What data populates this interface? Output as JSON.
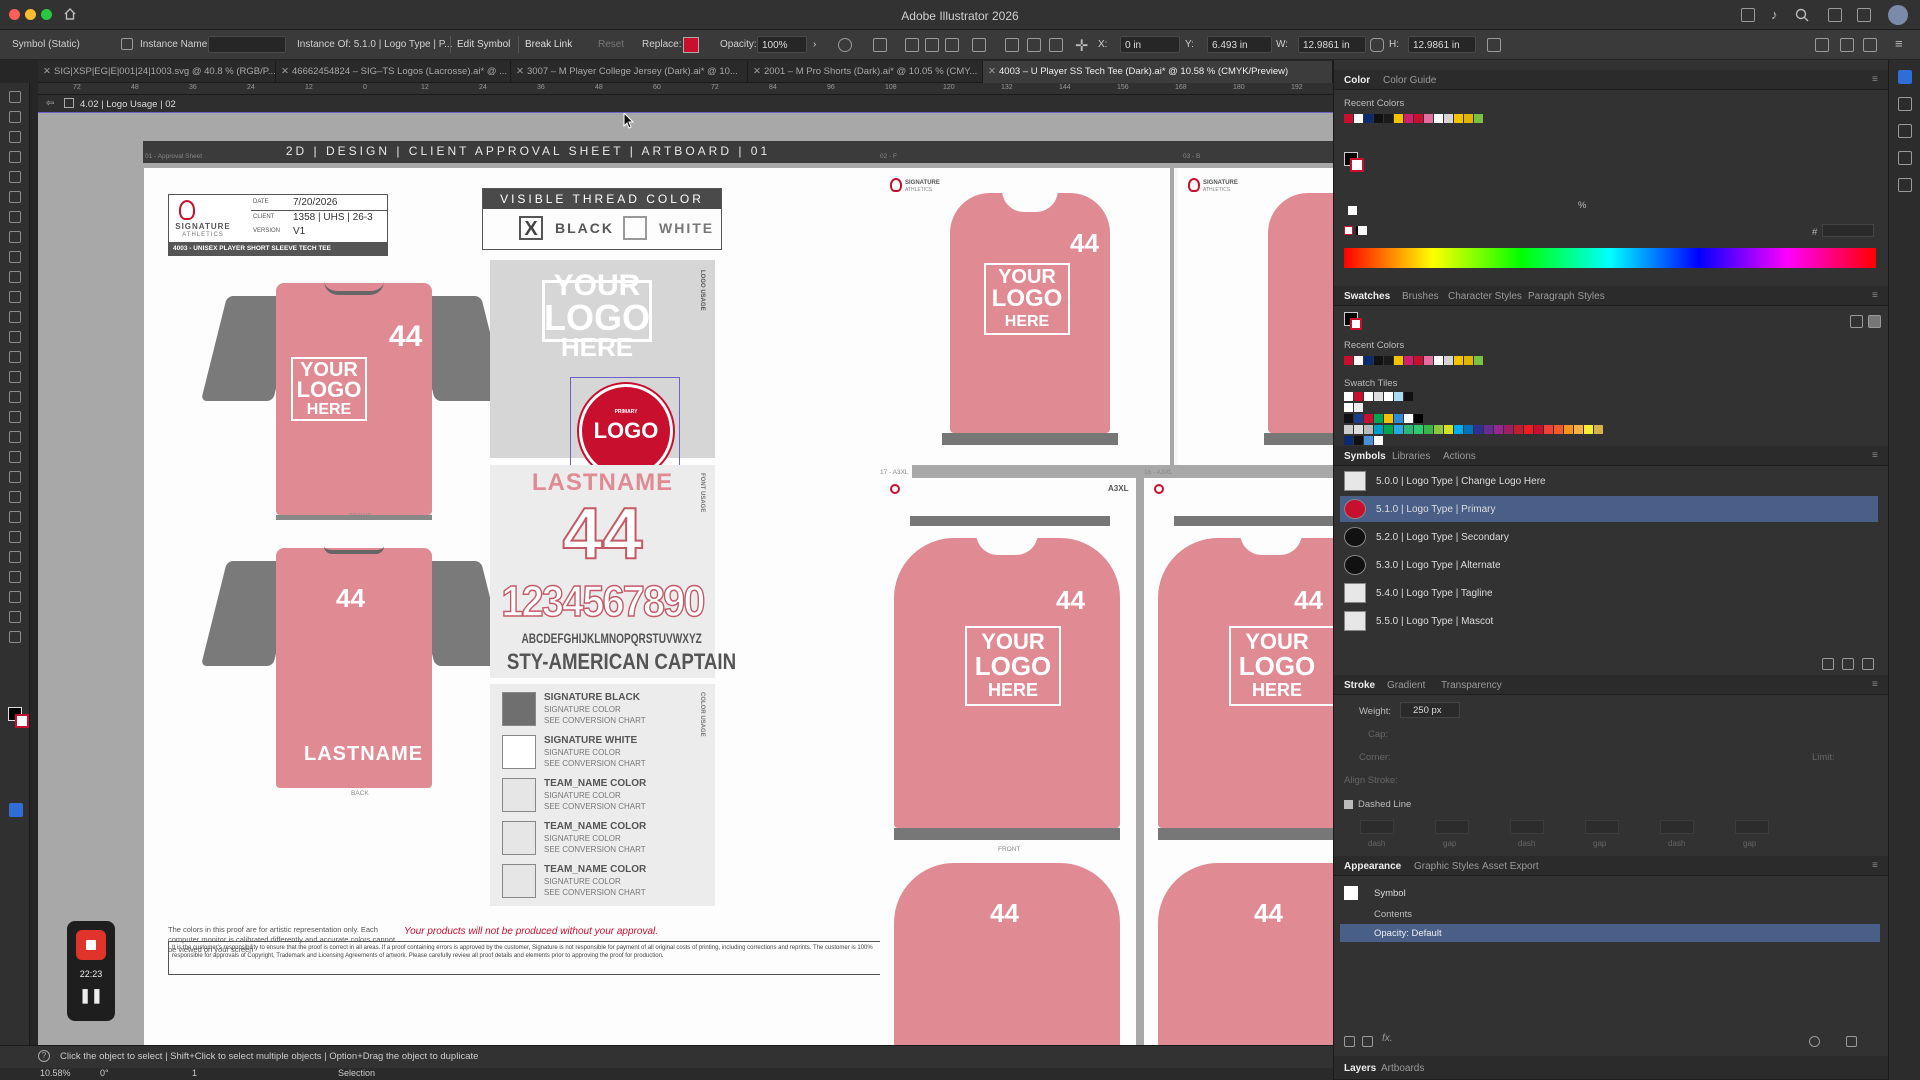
{
  "app": {
    "title": "Adobe Illustrator 2026"
  },
  "control_bar": {
    "selection_type": "Symbol (Static)",
    "instance_name_label": "Instance Name:",
    "instance_of": "Instance Of: 5.1.0 | Logo Type | P...",
    "edit_symbol": "Edit Symbol",
    "break_link": "Break Link",
    "reset": "Reset",
    "replace_label": "Replace:",
    "opacity_label": "Opacity:",
    "opacity_value": "100%",
    "x_label": "X:",
    "x_value": "0 in",
    "y_label": "Y:",
    "y_value": "6.493 in",
    "w_label": "W:",
    "w_value": "12.9861 in",
    "h_label": "H:",
    "h_value": "12.9861 in"
  },
  "doc_tabs": [
    "SIG|XSP|EG|E|001|24|1003.svg @ 40.8 % (RGB/P...",
    "46662454824 – SIG–TS Logos (Lacrosse).ai* @ ...",
    "3007 – M Player College Jersey (Dark).ai* @ 10...",
    "2001 – M Pro Shorts (Dark).ai* @ 10.05 % (CMY...",
    "4003 – U Player SS Tech Tee (Dark).ai* @ 10.58 % (CMYK/Preview)"
  ],
  "isolation": {
    "label": "4.02 | Logo Usage | 02"
  },
  "ruler_ticks": [
    "72",
    "48",
    "36",
    "24",
    "12",
    "0",
    "12",
    "24",
    "36",
    "48",
    "60",
    "72",
    "84",
    "96",
    "108",
    "120",
    "132",
    "144",
    "156",
    "168",
    "180",
    "192"
  ],
  "artboard": {
    "header": "2D  |  DESIGN  |  CLIENT APPROVAL SHEET  |  ARTBOARD  |  01",
    "artboard_name": "01 - Approval Sheet",
    "info": {
      "date_label": "DATE",
      "date": "7/20/2026",
      "client_label": "CLIENT",
      "client": "1358 | UHS | 26-3",
      "version_label": "VERSION",
      "version": "V1",
      "brand": "SIGNATURE",
      "brand_sub": "ATHLETICS",
      "product": "4003 - UNISEX PLAYER SHORT SLEEVE TECH TEE"
    },
    "thread": {
      "title": "VISIBLE THREAD COLOR",
      "black": "BLACK",
      "white": "WHITE",
      "checked_mark": "X"
    },
    "logo_usage_label": "LOGO USAGE",
    "your_logo": [
      "YOUR",
      "LOGO",
      "HERE"
    ],
    "primary_logo_small": "PRIMARY",
    "primary_logo": "LOGO",
    "font_usage_label": "FONT USAGE",
    "lastname": "LASTNAME",
    "number": "44",
    "digits": "1234567890",
    "alphabet": "ABCDEFGHIJKLMNOPQRSTUVWXYZ",
    "font_name": "STY-AMERICAN CAPTAIN",
    "color_usage_label": "COLOR USAGE",
    "colors": [
      {
        "name": "SIGNATURE BLACK",
        "l1": "SIGNATURE COLOR",
        "l2": "SEE CONVERSION CHART",
        "hex": "#6f6f6f"
      },
      {
        "name": "SIGNATURE WHITE",
        "l1": "SIGNATURE COLOR",
        "l2": "SEE CONVERSION CHART",
        "hex": "#ffffff"
      },
      {
        "name": "TEAM_NAME COLOR",
        "l1": "SIGNATURE COLOR",
        "l2": "SEE CONVERSION CHART",
        "hex": "#e6e6e6"
      },
      {
        "name": "TEAM_NAME COLOR",
        "l1": "SIGNATURE COLOR",
        "l2": "SEE CONVERSION CHART",
        "hex": "#e6e6e6"
      },
      {
        "name": "TEAM_NAME COLOR",
        "l1": "SIGNATURE COLOR",
        "l2": "SEE CONVERSION CHART",
        "hex": "#e6e6e6"
      }
    ],
    "front_label": "FRONT",
    "back_label": "BACK",
    "back_name": "LASTNAME",
    "disclaimer": "The colors in this proof are for artistic representation only. Each computer monitor is calibrated differently and accurate colors cannot be viewed on your screen",
    "warning": "Your products will not be produced without your approval.",
    "legal": "It is the customer's responsibility to ensure that the proof is correct in all areas. If a proof containing errors is approved by the customer, Signature is not responsible for payment of all original costs of printing, including corrections and reprints. The customer is 100% responsible for approvals of Copyright, Trademark and Licensing Agreements of artwork. Please carefully review all proof details and elements prior to approving the proof for production.",
    "side_boards": [
      "02 - F",
      "03 - B",
      "17 - A3XL",
      "16 - A3XL"
    ],
    "size_tag": "A3XL",
    "front_tag": "FRONT"
  },
  "recording": {
    "time": "22:23"
  },
  "status": {
    "hint": "Click the object to select  |  Shift+Click to select multiple objects  |  Option+Drag the object to duplicate",
    "zoom": "10.58%",
    "rotation": "0°",
    "page": "1",
    "mode": "Selection"
  },
  "panels": {
    "color_tabs": [
      "Color",
      "Color Guide"
    ],
    "recent_colors": "Recent Colors",
    "swatch_tabs": [
      "Swatches",
      "Brushes",
      "Character Styles",
      "Paragraph Styles"
    ],
    "swatch_tiles": "Swatch Tiles",
    "symbol_tabs": [
      "Symbols",
      "Libraries",
      "Actions"
    ],
    "symbols": [
      "5.0.0 | Logo Type | Change Logo Here",
      "5.1.0 | Logo Type | Primary",
      "5.2.0 | Logo Type | Secondary",
      "5.3.0 | Logo Type | Alternate",
      "5.4.0 | Logo Type | Tagline",
      "5.5.0 | Logo Type | Mascot"
    ],
    "stroke_tabs": [
      "Stroke",
      "Gradient",
      "Transparency"
    ],
    "weight_label": "Weight:",
    "weight_value": "250 px",
    "cap_label": "Cap:",
    "corner_label": "Corner:",
    "limit_label": "Limit:",
    "align_label": "Align Stroke:",
    "dashed_line": "Dashed Line",
    "dash_labels": [
      "dash",
      "gap",
      "dash",
      "gap",
      "dash",
      "gap"
    ],
    "appearance_tabs": [
      "Appearance",
      "Graphic Styles",
      "Asset Export"
    ],
    "appearance_symbol": "Symbol",
    "appearance_contents": "Contents",
    "appearance_opacity": "Opacity: Default",
    "layer_tabs": [
      "Layers",
      "Artboards"
    ],
    "hash": "#",
    "percent": "%"
  }
}
